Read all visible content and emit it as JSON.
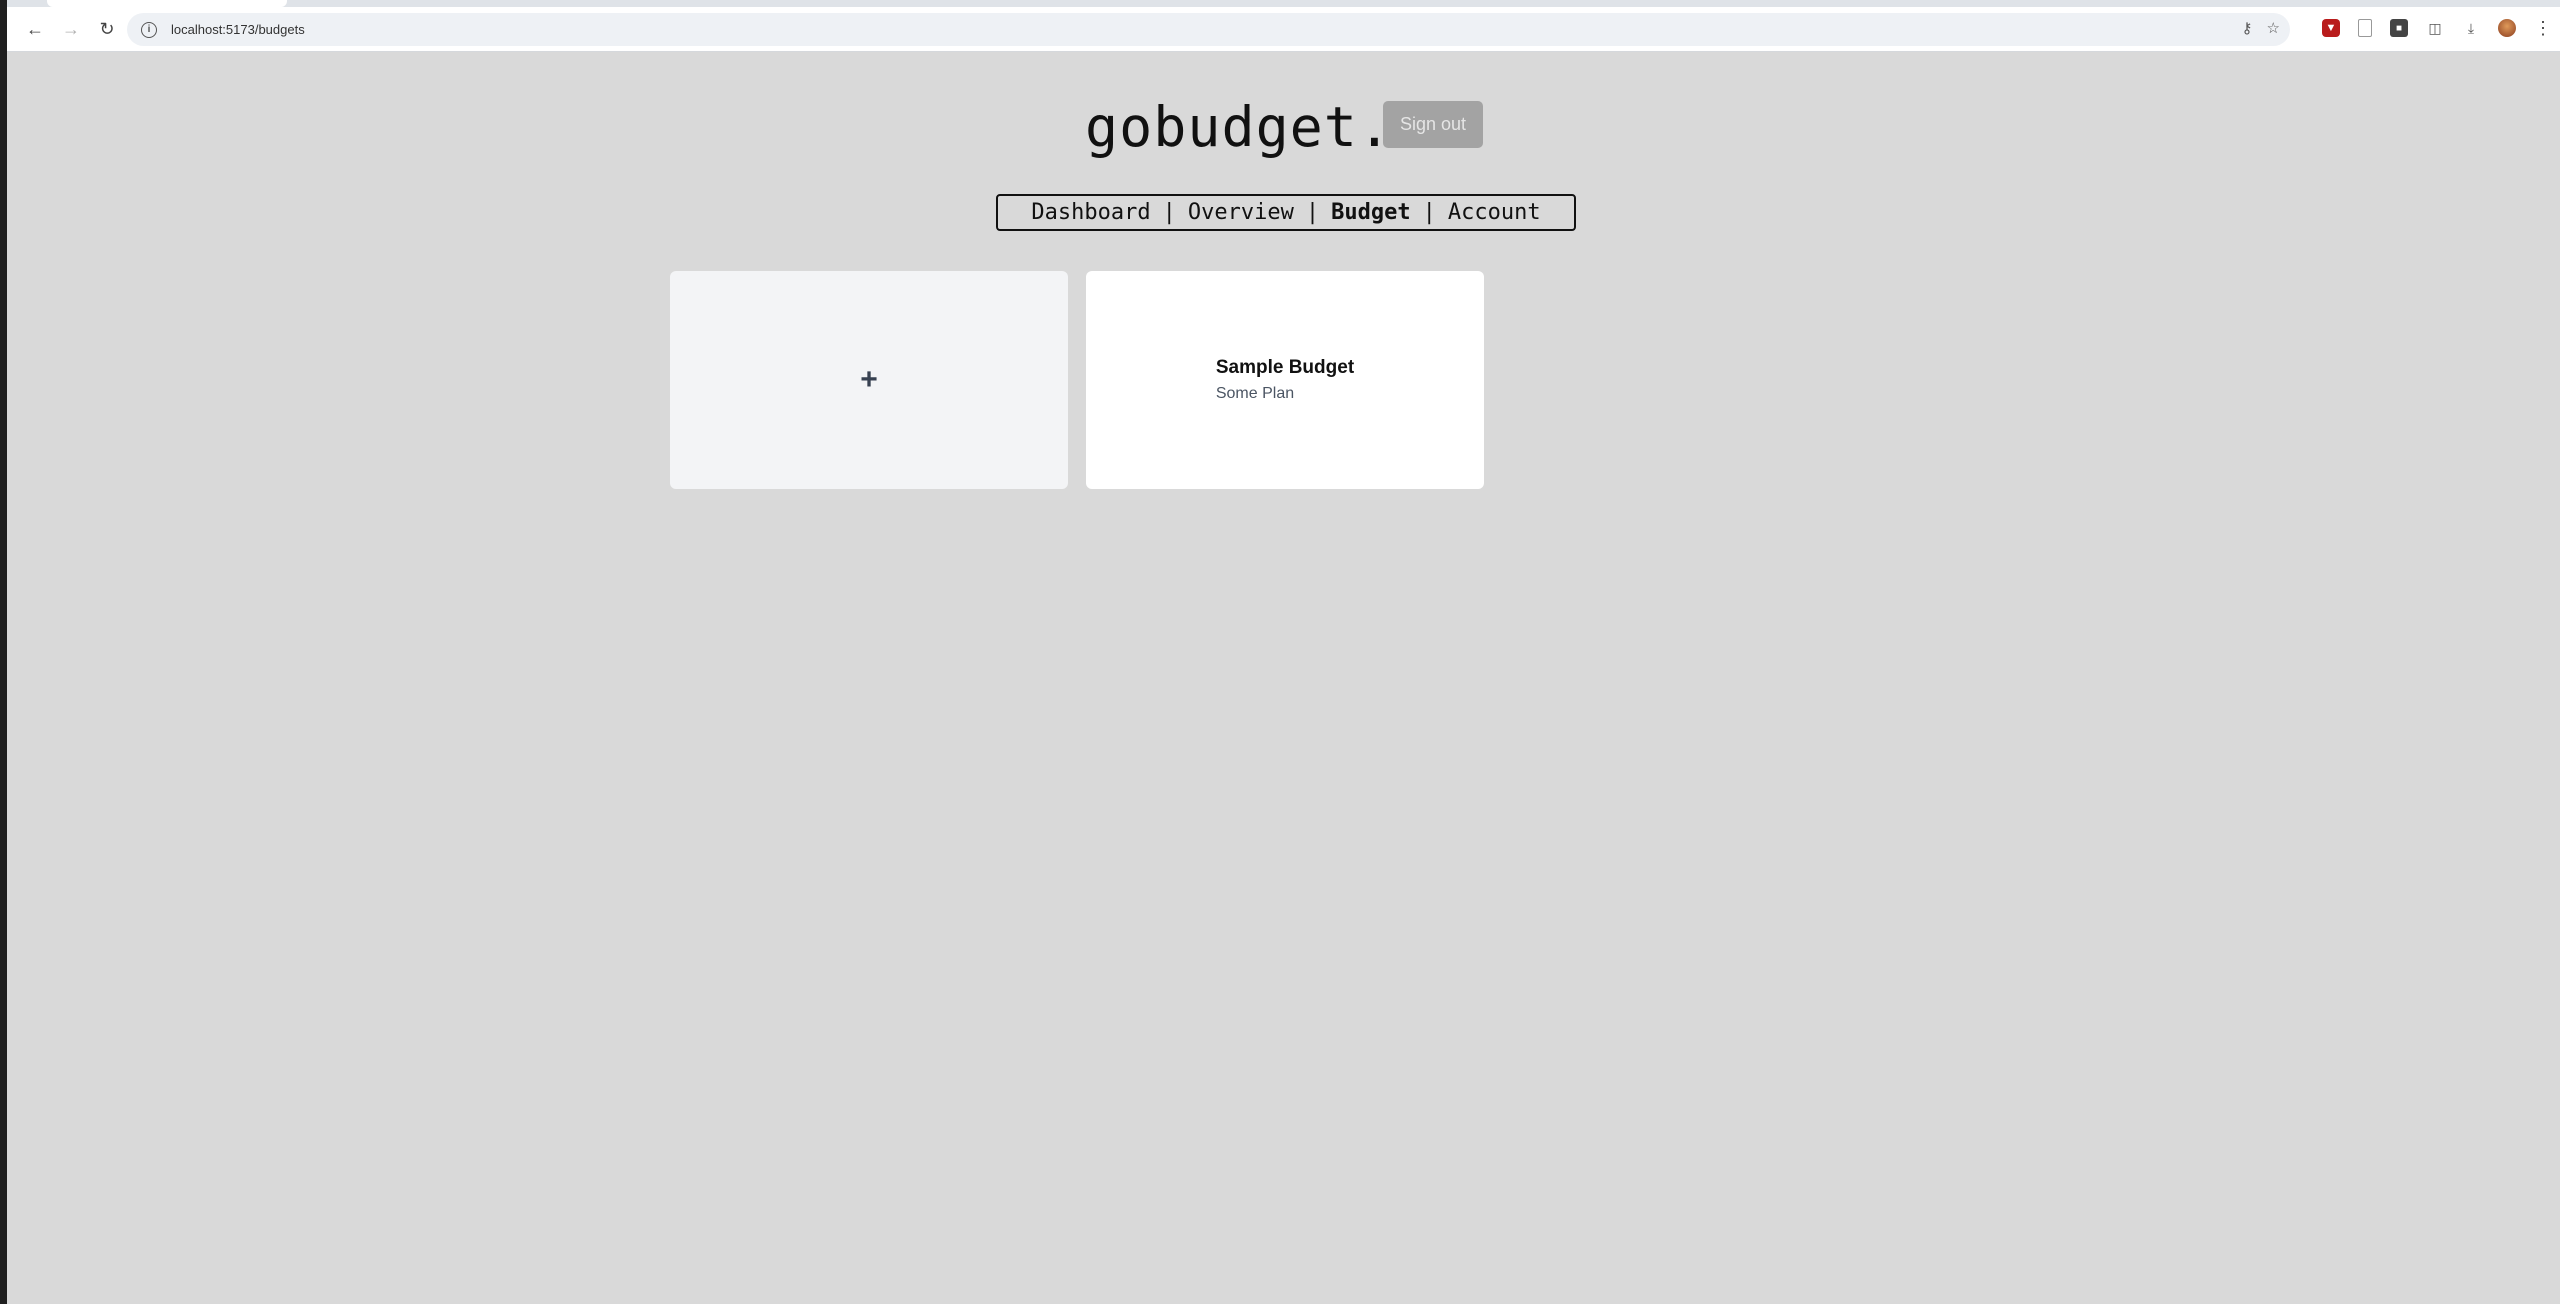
{
  "browser": {
    "url": "localhost:5173/budgets",
    "back_icon": "arrow-left-icon",
    "forward_icon": "arrow-right-icon",
    "reload_icon": "reload-icon"
  },
  "app": {
    "logo": "gobudget.",
    "sign_out_label": "Sign out"
  },
  "nav": {
    "items": [
      {
        "label": "Dashboard"
      },
      {
        "label": "Overview"
      },
      {
        "label": "Budget"
      },
      {
        "label": "Account"
      }
    ],
    "separator": "|",
    "active": "Budget"
  },
  "budgets": {
    "add_label": "+",
    "cards": [
      {
        "title": "Sample Budget",
        "subtitle": "Some Plan"
      }
    ]
  },
  "colors": {
    "page_bg": "#d9d9d9",
    "sign_out_bg": "#a3a3a3",
    "add_card_bg": "#f3f4f6",
    "card_bg": "#ffffff"
  }
}
